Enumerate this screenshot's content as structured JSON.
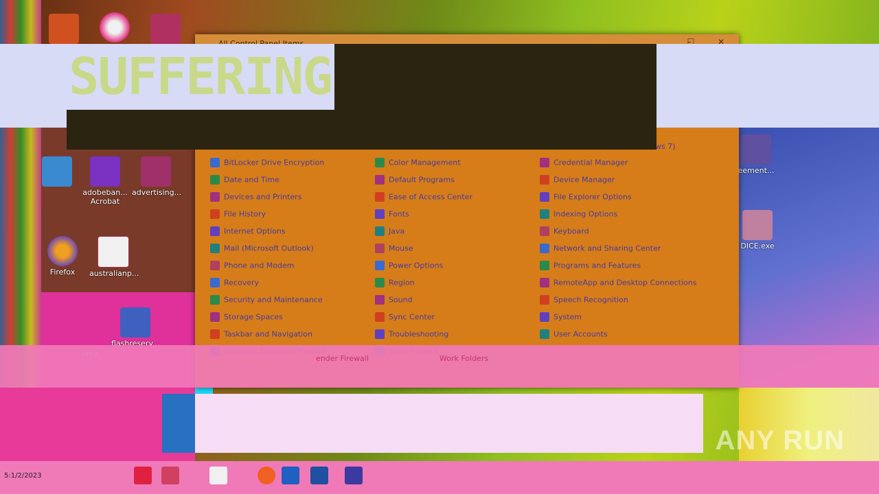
{
  "overlay": {
    "banner_text": "SUFFERING"
  },
  "window": {
    "title": "All Control Panel Items",
    "controls": {
      "minimize": "–",
      "maximize": "☐",
      "close": "✕"
    }
  },
  "control_panel": {
    "column1": [
      "BitLocker Drive Encryption",
      "Date and Time",
      "Devices and Printers",
      "File History",
      "Internet Options",
      "Mail (Microsoft Outlook)",
      "Phone and Modem",
      "Recovery",
      "Security and Maintenance",
      "Storage Spaces",
      "Taskbar and Navigation",
      "Windows Defender Firewall"
    ],
    "column2": [
      "Color Management",
      "Default Programs",
      "Ease of Access Center",
      "Fonts",
      "Java",
      "Mouse",
      "Power Options",
      "Region",
      "Sound",
      "Sync Center",
      "Troubleshooting",
      "Work Folders"
    ],
    "column3": [
      "Credential Manager",
      "Device Manager",
      "File Explorer Options",
      "Indexing Options",
      "Keyboard",
      "Network and Sharing Center",
      "Programs and Features",
      "RemoteApp and Desktop Connections",
      "Speech Recognition",
      "System",
      "User Accounts"
    ],
    "header_fragment": "ws 7)",
    "ghost_texts": [
      "ender Firewall",
      "Work Folders"
    ]
  },
  "desktop_icons": [
    {
      "label": "Acrobat"
    },
    {
      "label": "adobeban..."
    },
    {
      "label": "advertising..."
    },
    {
      "label": "Firefox"
    },
    {
      "label": "australianp..."
    },
    {
      "label": "flashreserv..."
    },
    {
      "label": "ome"
    },
    {
      "label": "eement..."
    },
    {
      "label": "DICE.exe"
    }
  ],
  "watermark": "ANY RUN",
  "clock_fragment": "5:1/2/2023"
}
